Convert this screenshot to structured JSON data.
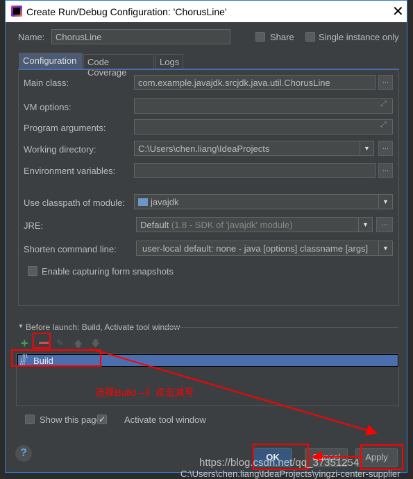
{
  "window": {
    "title": "Create Run/Debug Configuration: 'ChorusLine'",
    "close_icon": "close-icon"
  },
  "name": {
    "label": "Name:",
    "value": "ChorusLine"
  },
  "share": {
    "label": "Share",
    "checked": false
  },
  "single_instance": {
    "label": "Single instance only",
    "checked": false
  },
  "tabs": [
    {
      "label": "Configuration",
      "active": true
    },
    {
      "label": "Code Coverage"
    },
    {
      "label": "Logs"
    }
  ],
  "form": {
    "main_class": {
      "label": "Main class:",
      "value": "com.example.javajdk.srcjdk.java.util.ChorusLine"
    },
    "vm_options": {
      "label": "VM options:",
      "value": ""
    },
    "program_arguments": {
      "label": "Program arguments:",
      "value": ""
    },
    "working_directory": {
      "label": "Working directory:",
      "value": "C:\\Users\\chen.liang\\IdeaProjects"
    },
    "environment_variables": {
      "label": "Environment variables:",
      "value": ""
    },
    "classpath_module": {
      "label": "Use classpath of module:",
      "value": "javajdk"
    },
    "jre": {
      "label": "JRE:",
      "value": "Default",
      "hint": "(1.8 - SDK of 'javajdk' module)"
    },
    "shorten_command_line": {
      "label": "Shorten command line:",
      "value": "user-local default: none - java [options] classname [args]"
    },
    "capture_snapshots": {
      "label": "Enable capturing form snapshots",
      "checked": false
    },
    "browse_label": "..."
  },
  "before_launch": {
    "title": "Before launch: Build, Activate tool window",
    "items": [
      "Build"
    ]
  },
  "show_page": {
    "label": "Show this page",
    "checked": false
  },
  "activate_tool": {
    "label": "Activate tool window",
    "checked": true
  },
  "buttons": {
    "ok": "OK",
    "cancel": "Cancel",
    "apply": "Apply",
    "help": "?"
  },
  "annotation": {
    "text": "选择Build --》点击减号",
    "color": "#ff0000"
  },
  "watermark": "https://blog.csdn.net/qq_37351254",
  "background_text": "C:\\Users\\chen.liang\\IdeaProjects\\yingzi-center-supplier",
  "colors": {
    "selection": "#4b6eaf",
    "dialog_bg": "#3c3f41",
    "border": "#2f7fd6"
  }
}
